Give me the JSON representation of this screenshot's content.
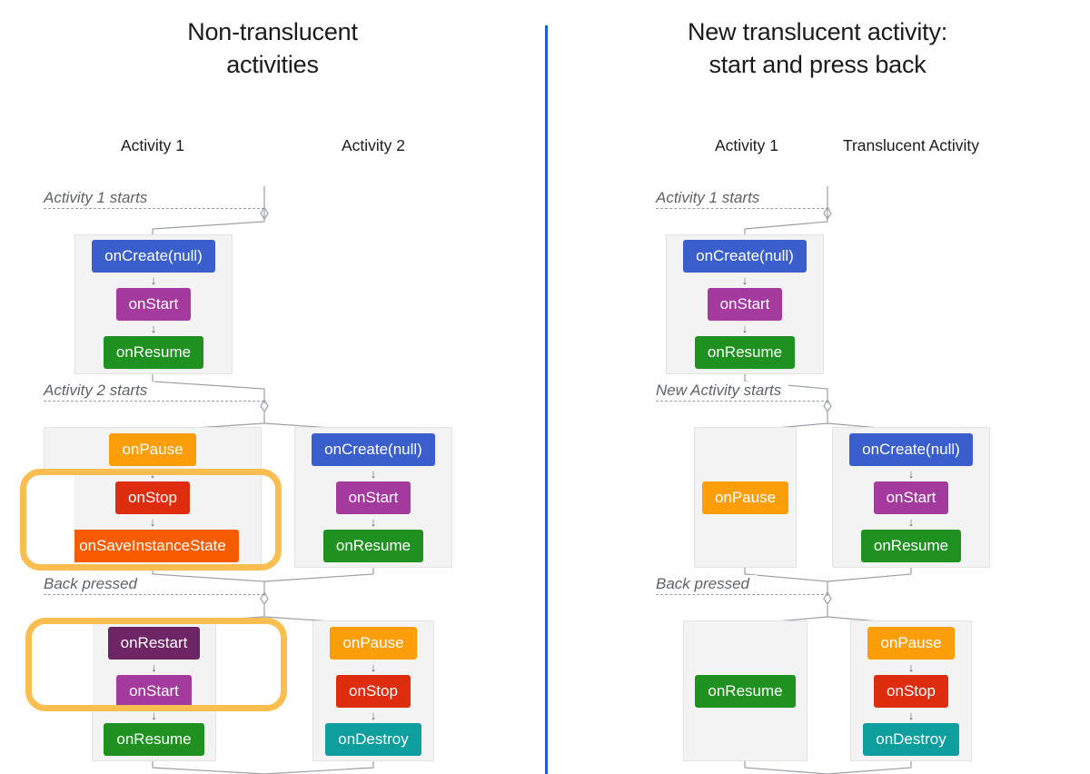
{
  "theme": {
    "divider_color": "#1d5bd6",
    "highlight_color": "#fabe50",
    "panel_bg": "#f3f3f3",
    "dash_color": "#9aa0a6",
    "callback_colors": {
      "onCreate": "#3a5fcd",
      "onStart": "#a4399e",
      "onRestart": "#6d2565",
      "onResume": "#1f9120",
      "onPause": "#fb9e09",
      "onStop": "#de2c0f",
      "onSaveInstanceState": "#f95b00",
      "onDestroy": "#0f9e9e"
    }
  },
  "left": {
    "title": "Non-translucent\nactivities",
    "title_line1": "Non-translucent",
    "title_line2": "activities",
    "columns": [
      "Activity 1",
      "Activity 2"
    ],
    "column_1": "Activity 1",
    "column_2": "Activity 2",
    "events": {
      "e1": "Activity 1 starts",
      "e2": "Activity 2 starts",
      "e3": "Back pressed"
    },
    "stage1": {
      "col1": [
        "onCreate(null)",
        "onStart",
        "onResume"
      ],
      "col2": []
    },
    "stage2": {
      "col1": [
        "onPause",
        "onStop",
        "onSaveInstanceState"
      ],
      "col2": [
        "onCreate(null)",
        "onStart",
        "onResume"
      ]
    },
    "stage3": {
      "col1": [
        "onRestart",
        "onStart",
        "onResume"
      ],
      "col2": [
        "onPause",
        "onStop",
        "onDestroy"
      ]
    },
    "stage1_c1_b1": "onCreate(null)",
    "stage1_c1_b2": "onStart",
    "stage1_c1_b3": "onResume",
    "stage2_c1_b1": "onPause",
    "stage2_c1_b2": "onStop",
    "stage2_c1_b3": "onSaveInstanceState",
    "stage2_c2_b1": "onCreate(null)",
    "stage2_c2_b2": "onStart",
    "stage2_c2_b3": "onResume",
    "stage3_c1_b1": "onRestart",
    "stage3_c1_b2": "onStart",
    "stage3_c1_b3": "onResume",
    "stage3_c2_b1": "onPause",
    "stage3_c2_b2": "onStop",
    "stage3_c2_b3": "onDestroy",
    "highlights": [
      "onStop + onSaveInstanceState",
      "onRestart + onStart"
    ]
  },
  "right": {
    "title_line1": "New translucent activity:",
    "title_line2": "start and press back",
    "columns": [
      "Activity 1",
      "Translucent Activity"
    ],
    "column_1": "Activity 1",
    "column_2": "Translucent Activity",
    "events": {
      "e1": "Activity 1 starts",
      "e2": "New Activity starts",
      "e3": "Back pressed"
    },
    "stage1": {
      "col1": [
        "onCreate(null)",
        "onStart",
        "onResume"
      ],
      "col2": []
    },
    "stage2": {
      "col1": [
        "onPause"
      ],
      "col2": [
        "onCreate(null)",
        "onStart",
        "onResume"
      ]
    },
    "stage3": {
      "col1": [
        "onResume"
      ],
      "col2": [
        "onPause",
        "onStop",
        "onDestroy"
      ]
    },
    "stage1_c1_b1": "onCreate(null)",
    "stage1_c1_b2": "onStart",
    "stage1_c1_b3": "onResume",
    "stage2_c1_b1": "onPause",
    "stage2_c2_b1": "onCreate(null)",
    "stage2_c2_b2": "onStart",
    "stage2_c2_b3": "onResume",
    "stage3_c1_b1": "onResume",
    "stage3_c2_b1": "onPause",
    "stage3_c2_b2": "onStop",
    "stage3_c2_b3": "onDestroy"
  },
  "icons": {
    "flow_arrow": "↓"
  }
}
